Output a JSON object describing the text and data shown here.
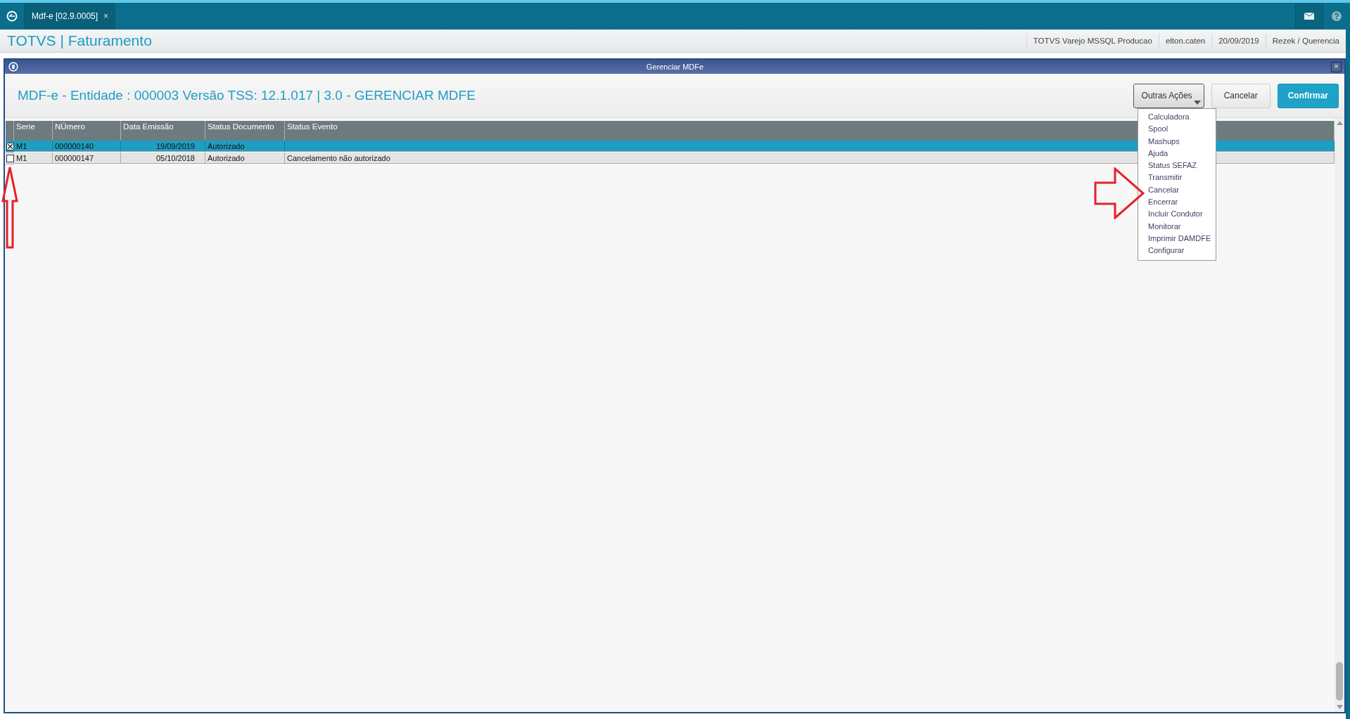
{
  "top_bar": {
    "tab": {
      "label": "Mdf-e [02.9.0005]",
      "close": "×",
      "selected": true
    }
  },
  "header": {
    "title": "TOTVS | Faturamento",
    "info": [
      "TOTVS Varejo MSSQL Producao",
      "elton.caten",
      "20/09/2019",
      "Rezek / Querencia"
    ]
  },
  "dialog": {
    "title": "Gerenciar MDFe",
    "close": "×",
    "heading": "MDF-e - Entidade : 000003 Versão TSS: 12.1.017 | 3.0 - GERENCIAR MDFE",
    "buttons": [
      {
        "label": "Outras Ações",
        "kind": "dropdown",
        "expanded": true
      },
      {
        "label": "Cancelar",
        "kind": "secondary"
      },
      {
        "label": "Confirmar",
        "kind": "primary"
      }
    ],
    "menu": [
      "Calculadora",
      "Spool",
      "Mashups",
      "Ajuda",
      "Status SEFAZ",
      "Transmitir",
      "Cancelar",
      "Encerrar",
      "Incluir Condutor",
      "Monitorar",
      "Imprimir DAMDFE",
      "Configurar"
    ],
    "table": {
      "columns": [
        "Serie",
        "NÚmero",
        "Data Emissão",
        "Status Documento",
        "Status Evento"
      ],
      "rows": [
        {
          "checked": true,
          "selected": true,
          "cells": [
            "M1",
            "000000140",
            "19/09/2019",
            "Autorizado",
            ""
          ]
        },
        {
          "checked": false,
          "selected": false,
          "cells": [
            "M1",
            "000000147",
            "05/10/2018",
            "Autorizado",
            "Cancelamento não autorizado"
          ]
        }
      ]
    }
  }
}
